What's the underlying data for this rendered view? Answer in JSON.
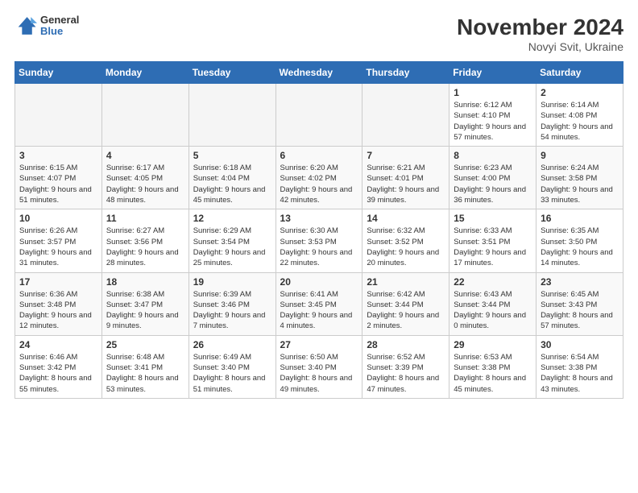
{
  "logo": {
    "general": "General",
    "blue": "Blue"
  },
  "title": "November 2024",
  "subtitle": "Novyi Svit, Ukraine",
  "days_of_week": [
    "Sunday",
    "Monday",
    "Tuesday",
    "Wednesday",
    "Thursday",
    "Friday",
    "Saturday"
  ],
  "weeks": [
    [
      {
        "day": "",
        "info": ""
      },
      {
        "day": "",
        "info": ""
      },
      {
        "day": "",
        "info": ""
      },
      {
        "day": "",
        "info": ""
      },
      {
        "day": "",
        "info": ""
      },
      {
        "day": "1",
        "info": "Sunrise: 6:12 AM\nSunset: 4:10 PM\nDaylight: 9 hours and 57 minutes."
      },
      {
        "day": "2",
        "info": "Sunrise: 6:14 AM\nSunset: 4:08 PM\nDaylight: 9 hours and 54 minutes."
      }
    ],
    [
      {
        "day": "3",
        "info": "Sunrise: 6:15 AM\nSunset: 4:07 PM\nDaylight: 9 hours and 51 minutes."
      },
      {
        "day": "4",
        "info": "Sunrise: 6:17 AM\nSunset: 4:05 PM\nDaylight: 9 hours and 48 minutes."
      },
      {
        "day": "5",
        "info": "Sunrise: 6:18 AM\nSunset: 4:04 PM\nDaylight: 9 hours and 45 minutes."
      },
      {
        "day": "6",
        "info": "Sunrise: 6:20 AM\nSunset: 4:02 PM\nDaylight: 9 hours and 42 minutes."
      },
      {
        "day": "7",
        "info": "Sunrise: 6:21 AM\nSunset: 4:01 PM\nDaylight: 9 hours and 39 minutes."
      },
      {
        "day": "8",
        "info": "Sunrise: 6:23 AM\nSunset: 4:00 PM\nDaylight: 9 hours and 36 minutes."
      },
      {
        "day": "9",
        "info": "Sunrise: 6:24 AM\nSunset: 3:58 PM\nDaylight: 9 hours and 33 minutes."
      }
    ],
    [
      {
        "day": "10",
        "info": "Sunrise: 6:26 AM\nSunset: 3:57 PM\nDaylight: 9 hours and 31 minutes."
      },
      {
        "day": "11",
        "info": "Sunrise: 6:27 AM\nSunset: 3:56 PM\nDaylight: 9 hours and 28 minutes."
      },
      {
        "day": "12",
        "info": "Sunrise: 6:29 AM\nSunset: 3:54 PM\nDaylight: 9 hours and 25 minutes."
      },
      {
        "day": "13",
        "info": "Sunrise: 6:30 AM\nSunset: 3:53 PM\nDaylight: 9 hours and 22 minutes."
      },
      {
        "day": "14",
        "info": "Sunrise: 6:32 AM\nSunset: 3:52 PM\nDaylight: 9 hours and 20 minutes."
      },
      {
        "day": "15",
        "info": "Sunrise: 6:33 AM\nSunset: 3:51 PM\nDaylight: 9 hours and 17 minutes."
      },
      {
        "day": "16",
        "info": "Sunrise: 6:35 AM\nSunset: 3:50 PM\nDaylight: 9 hours and 14 minutes."
      }
    ],
    [
      {
        "day": "17",
        "info": "Sunrise: 6:36 AM\nSunset: 3:48 PM\nDaylight: 9 hours and 12 minutes."
      },
      {
        "day": "18",
        "info": "Sunrise: 6:38 AM\nSunset: 3:47 PM\nDaylight: 9 hours and 9 minutes."
      },
      {
        "day": "19",
        "info": "Sunrise: 6:39 AM\nSunset: 3:46 PM\nDaylight: 9 hours and 7 minutes."
      },
      {
        "day": "20",
        "info": "Sunrise: 6:41 AM\nSunset: 3:45 PM\nDaylight: 9 hours and 4 minutes."
      },
      {
        "day": "21",
        "info": "Sunrise: 6:42 AM\nSunset: 3:44 PM\nDaylight: 9 hours and 2 minutes."
      },
      {
        "day": "22",
        "info": "Sunrise: 6:43 AM\nSunset: 3:44 PM\nDaylight: 9 hours and 0 minutes."
      },
      {
        "day": "23",
        "info": "Sunrise: 6:45 AM\nSunset: 3:43 PM\nDaylight: 8 hours and 57 minutes."
      }
    ],
    [
      {
        "day": "24",
        "info": "Sunrise: 6:46 AM\nSunset: 3:42 PM\nDaylight: 8 hours and 55 minutes."
      },
      {
        "day": "25",
        "info": "Sunrise: 6:48 AM\nSunset: 3:41 PM\nDaylight: 8 hours and 53 minutes."
      },
      {
        "day": "26",
        "info": "Sunrise: 6:49 AM\nSunset: 3:40 PM\nDaylight: 8 hours and 51 minutes."
      },
      {
        "day": "27",
        "info": "Sunrise: 6:50 AM\nSunset: 3:40 PM\nDaylight: 8 hours and 49 minutes."
      },
      {
        "day": "28",
        "info": "Sunrise: 6:52 AM\nSunset: 3:39 PM\nDaylight: 8 hours and 47 minutes."
      },
      {
        "day": "29",
        "info": "Sunrise: 6:53 AM\nSunset: 3:38 PM\nDaylight: 8 hours and 45 minutes."
      },
      {
        "day": "30",
        "info": "Sunrise: 6:54 AM\nSunset: 3:38 PM\nDaylight: 8 hours and 43 minutes."
      }
    ]
  ]
}
